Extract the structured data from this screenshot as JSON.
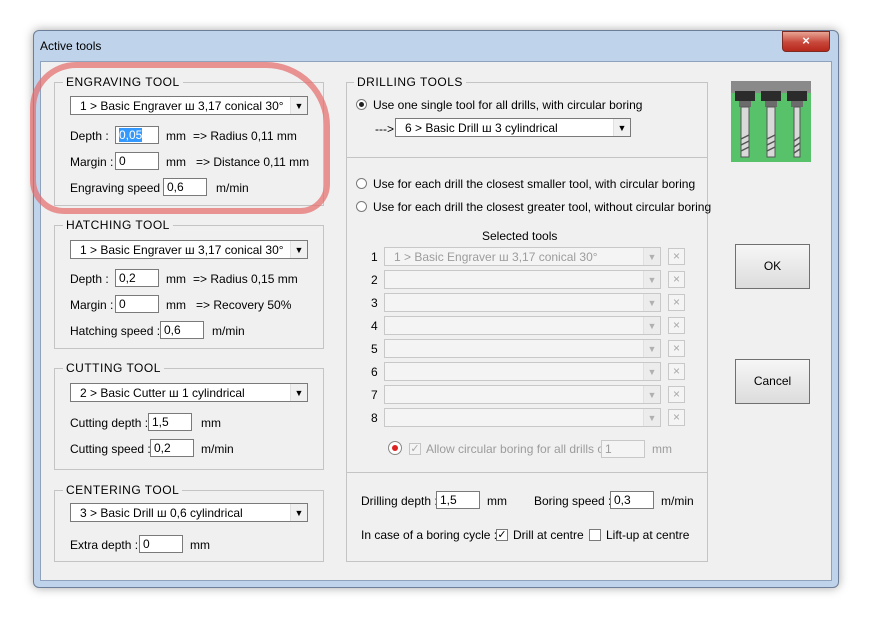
{
  "window": {
    "title": "Active tools",
    "close_icon": "×"
  },
  "engraving": {
    "title": "ENGRAVING TOOL",
    "tool": "1 > Basic Engraver   ш 3,17   conical 30°",
    "depth_label": "Depth :",
    "depth_value": "0,05",
    "depth_unit": "mm",
    "depth_info": "=> Radius 0,11 mm",
    "margin_label": "Margin :",
    "margin_value": "0",
    "margin_unit": "mm",
    "margin_info": "=> Distance 0,11 mm",
    "speed_label": "Engraving speed :",
    "speed_value": "0,6",
    "speed_unit": "m/min"
  },
  "hatching": {
    "title": "HATCHING TOOL",
    "tool": "1 > Basic Engraver   ш 3,17   conical 30°",
    "depth_label": "Depth :",
    "depth_value": "0,2",
    "depth_unit": "mm",
    "depth_info": "=> Radius 0,15 mm",
    "margin_label": "Margin :",
    "margin_value": "0",
    "margin_unit": "mm",
    "margin_info": "=> Recovery 50%",
    "speed_label": "Hatching speed :",
    "speed_value": "0,6",
    "speed_unit": "m/min"
  },
  "cutting": {
    "title": "CUTTING TOOL",
    "tool": "2 > Basic Cutter   ш 1   cylindrical",
    "depth_label": "Cutting depth :",
    "depth_value": "1,5",
    "depth_unit": "mm",
    "speed_label": "Cutting speed :",
    "speed_value": "0,2",
    "speed_unit": "m/min"
  },
  "centering": {
    "title": "CENTERING TOOL",
    "tool": "3 > Basic Drill   ш 0,6   cylindrical",
    "depth_label": "Extra depth :",
    "depth_value": "0",
    "depth_unit": "mm"
  },
  "drilling": {
    "title": "DRILLING TOOLS",
    "option_single": "Use one single tool for all drills, with circular boring",
    "arrow": "--->",
    "single_tool": "6 > Basic Drill   ш 3   cylindrical",
    "option_smaller": "Use for each drill the closest smaller tool, with circular boring",
    "option_greater": "Use for each drill the closest greater tool, without circular boring",
    "selected_header": "Selected tools",
    "selected": [
      {
        "num": "1",
        "tool": "1 > Basic Engraver   ш 3,17   conical 30°"
      },
      {
        "num": "2",
        "tool": ""
      },
      {
        "num": "3",
        "tool": ""
      },
      {
        "num": "4",
        "tool": ""
      },
      {
        "num": "5",
        "tool": ""
      },
      {
        "num": "6",
        "tool": ""
      },
      {
        "num": "7",
        "tool": ""
      },
      {
        "num": "8",
        "tool": ""
      }
    ],
    "remove_icon": "×",
    "circular_label": "Allow circular boring for all drills over",
    "circular_value": "1",
    "circular_unit": "mm",
    "depth_label": "Drilling depth :",
    "depth_value": "1,5",
    "depth_unit": "mm",
    "boring_label": "Boring speed :",
    "boring_value": "0,3",
    "boring_unit": "m/min",
    "cycle_label": "In case of a boring cycle :",
    "drill_centre": "Drill at centre",
    "liftup_centre": "Lift-up at centre"
  },
  "buttons": {
    "ok": "OK",
    "cancel": "Cancel"
  },
  "colors": {
    "window_frame": "#bfd3ea",
    "client_bg": "#f0f0f0",
    "annotation": "#e46e6e",
    "drill_icon_bg": "#58c26a"
  }
}
